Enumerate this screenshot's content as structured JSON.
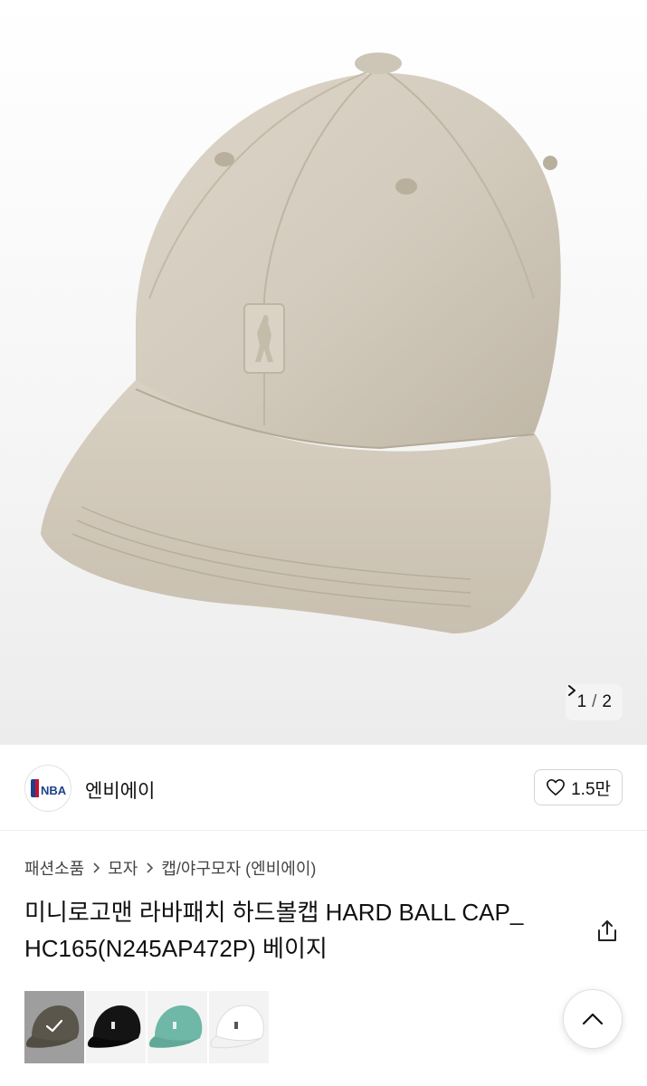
{
  "gallery": {
    "current": "1",
    "separator": "/",
    "total": "2"
  },
  "brand": {
    "logo_text": "NBA",
    "name": "엔비에이",
    "likes": "1.5만"
  },
  "breadcrumb": [
    "패션소품",
    "모자",
    "캡/야구모자 (엔비에이)"
  ],
  "product": {
    "title": "미니로고맨 라바패치 하드볼캡 HARD BALL CAP_ HC165(N245AP472P) 베이지"
  },
  "swatches": [
    {
      "color": "#8a8473",
      "icon": "cap-khaki",
      "selected": true
    },
    {
      "color": "#141414",
      "icon": "cap-black",
      "selected": false
    },
    {
      "color": "#6fb7a6",
      "icon": "cap-mint",
      "selected": false
    },
    {
      "color": "#f4f4f4",
      "icon": "cap-white",
      "selected": false
    }
  ],
  "colors": {
    "cap_beige": "#d3cbbd",
    "nba_blue": "#1d428a",
    "nba_red": "#c8102e"
  }
}
